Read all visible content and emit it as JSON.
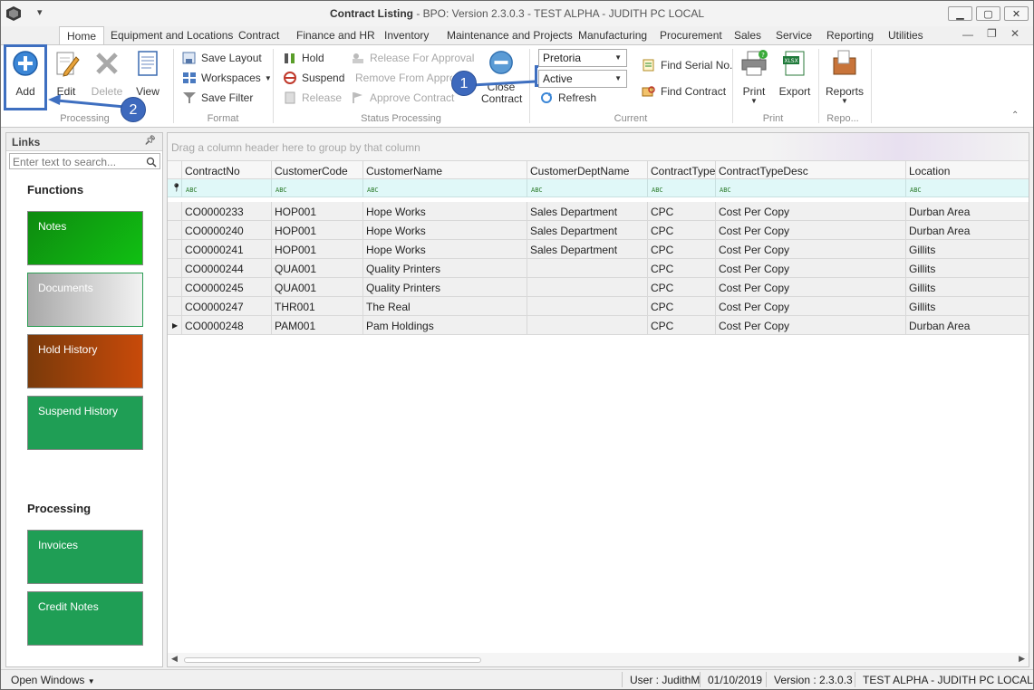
{
  "window": {
    "title_main": "Contract Listing",
    "title_rest": " - BPO: Version 2.3.0.3 - TEST ALPHA - JUDITH PC LOCAL",
    "controls": [
      "minimize-icon",
      "restore-icon",
      "close-icon"
    ]
  },
  "quick_access": {
    "dropdown_glyph": "▾"
  },
  "tabs": [
    {
      "label": "Home",
      "active": true
    },
    {
      "label": "Equipment and Locations"
    },
    {
      "label": "Contract"
    },
    {
      "label": "Finance and HR"
    },
    {
      "label": "Inventory"
    },
    {
      "label": "Maintenance and Projects"
    },
    {
      "label": "Manufacturing"
    },
    {
      "label": "Procurement"
    },
    {
      "label": "Sales"
    },
    {
      "label": "Service"
    },
    {
      "label": "Reporting"
    },
    {
      "label": "Utilities"
    }
  ],
  "ribbon": {
    "processing": {
      "label": "Processing",
      "add": "Add",
      "edit": "Edit",
      "delete": "Delete",
      "view": "View"
    },
    "format": {
      "label": "Format",
      "save_layout": "Save Layout",
      "workspaces": "Workspaces",
      "save_filter": "Save Filter"
    },
    "status": {
      "label": "Status Processing",
      "hold": "Hold",
      "suspend": "Suspend",
      "release": "Release",
      "release_approval": "Release For Approval",
      "remove_approval": "Remove From Approval",
      "approve": "Approve Contract",
      "close1": "Close",
      "close2": "Contract"
    },
    "current": {
      "label": "Current",
      "site": "Pretoria",
      "status": "Active",
      "refresh": "Refresh",
      "find_serial": "Find Serial No.",
      "find_contract": "Find Contract"
    },
    "print": {
      "label": "Print",
      "print": "Print",
      "export": "Export"
    },
    "reports": {
      "label": "Repo...",
      "reports": "Reports"
    }
  },
  "links_panel": {
    "title": "Links",
    "search_placeholder": "Enter text to search...",
    "functions_label": "Functions",
    "functions": [
      "Notes",
      "Documents",
      "Hold History",
      "Suspend History"
    ],
    "processing_label": "Processing",
    "processing": [
      "Invoices",
      "Credit Notes"
    ]
  },
  "grid": {
    "group_hint": "Drag a column header here to group by that column",
    "columns": [
      "ContractNo",
      "CustomerCode",
      "CustomerName",
      "CustomerDeptName",
      "ContractType",
      "ContractTypeDesc",
      "Location"
    ],
    "rows": [
      [
        "CO0000233",
        "HOP001",
        "Hope Works",
        "Sales Department",
        "CPC",
        "Cost Per Copy",
        "Durban Area"
      ],
      [
        "CO0000240",
        "HOP001",
        "Hope Works",
        "Sales Department",
        "CPC",
        "Cost Per Copy",
        "Durban Area"
      ],
      [
        "CO0000241",
        "HOP001",
        "Hope Works",
        "Sales Department",
        "CPC",
        "Cost Per Copy",
        "Gillits"
      ],
      [
        "CO0000244",
        "QUA001",
        "Quality Printers",
        "",
        "CPC",
        "Cost Per Copy",
        "Gillits"
      ],
      [
        "CO0000245",
        "QUA001",
        "Quality Printers",
        "",
        "CPC",
        "Cost Per Copy",
        "Gillits"
      ],
      [
        "CO0000247",
        "THR001",
        "The Real",
        "",
        "CPC",
        "Cost Per Copy",
        "Gillits"
      ],
      [
        "CO0000248",
        "PAM001",
        "Pam Holdings",
        "",
        "CPC",
        "Cost Per Copy",
        "Durban Area"
      ]
    ],
    "filter_glyph": "ABC"
  },
  "status_bar": {
    "open_windows": "Open Windows",
    "user": "User : JudithM",
    "date": "01/10/2019",
    "version": "Version : 2.3.0.3",
    "env": "TEST ALPHA - JUDITH PC LOCAL"
  },
  "annotations": {
    "step1": "1",
    "step2": "2",
    "color": "#3e6fc0"
  },
  "tile_colors": {
    "notes": "#0fa012",
    "documents": "#b8b8b8",
    "hold": "#a8400a",
    "suspend": "#1f9e55",
    "invoices": "#1f9e55",
    "credit": "#1f9e55"
  }
}
